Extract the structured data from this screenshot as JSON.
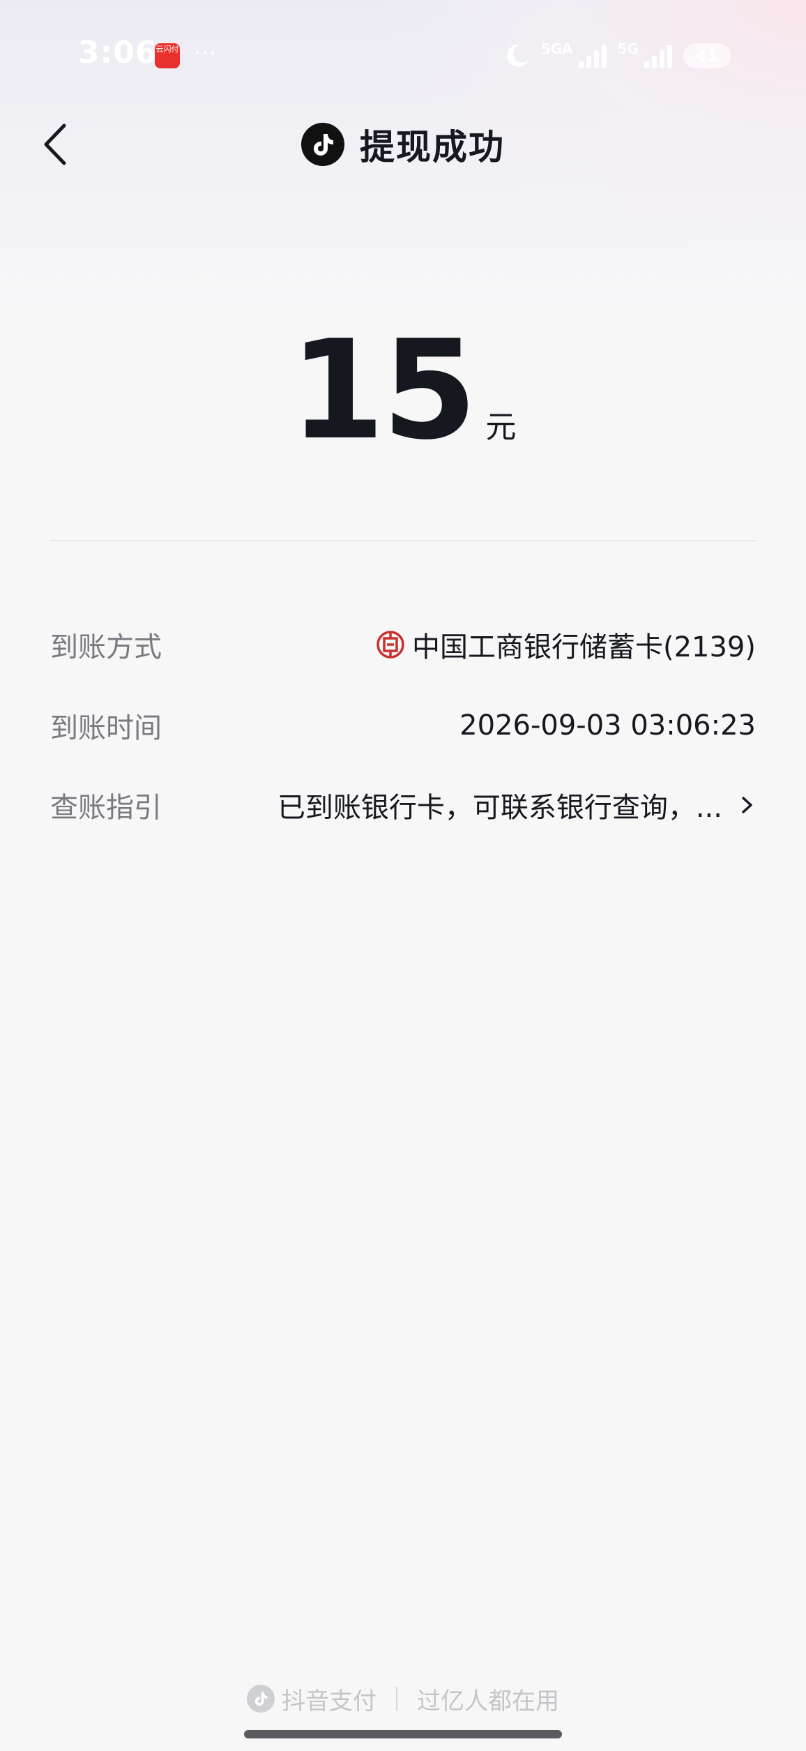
{
  "status_bar": {
    "time": "3:06",
    "app_badge": "云闪付",
    "more": "···",
    "network_1": "5GA",
    "network_2": "5G",
    "battery": "41"
  },
  "nav": {
    "title": "提现成功"
  },
  "amount": {
    "value": "15",
    "unit": "元"
  },
  "details": [
    {
      "label": "到账方式",
      "value": "中国工商银行储蓄卡(2139)"
    },
    {
      "label": "到账时间",
      "value": "2026-09-03 03:06:23"
    },
    {
      "label": "查账指引",
      "value": "已到账银行卡，可联系银行查询，..."
    }
  ],
  "footer": {
    "brand": "抖音支付",
    "slogan": "过亿人都在用"
  },
  "colors": {
    "text_primary": "#16181f",
    "text_secondary": "#787a80",
    "bank_red": "#c8322e",
    "footer_gray": "#c4c5c9"
  }
}
